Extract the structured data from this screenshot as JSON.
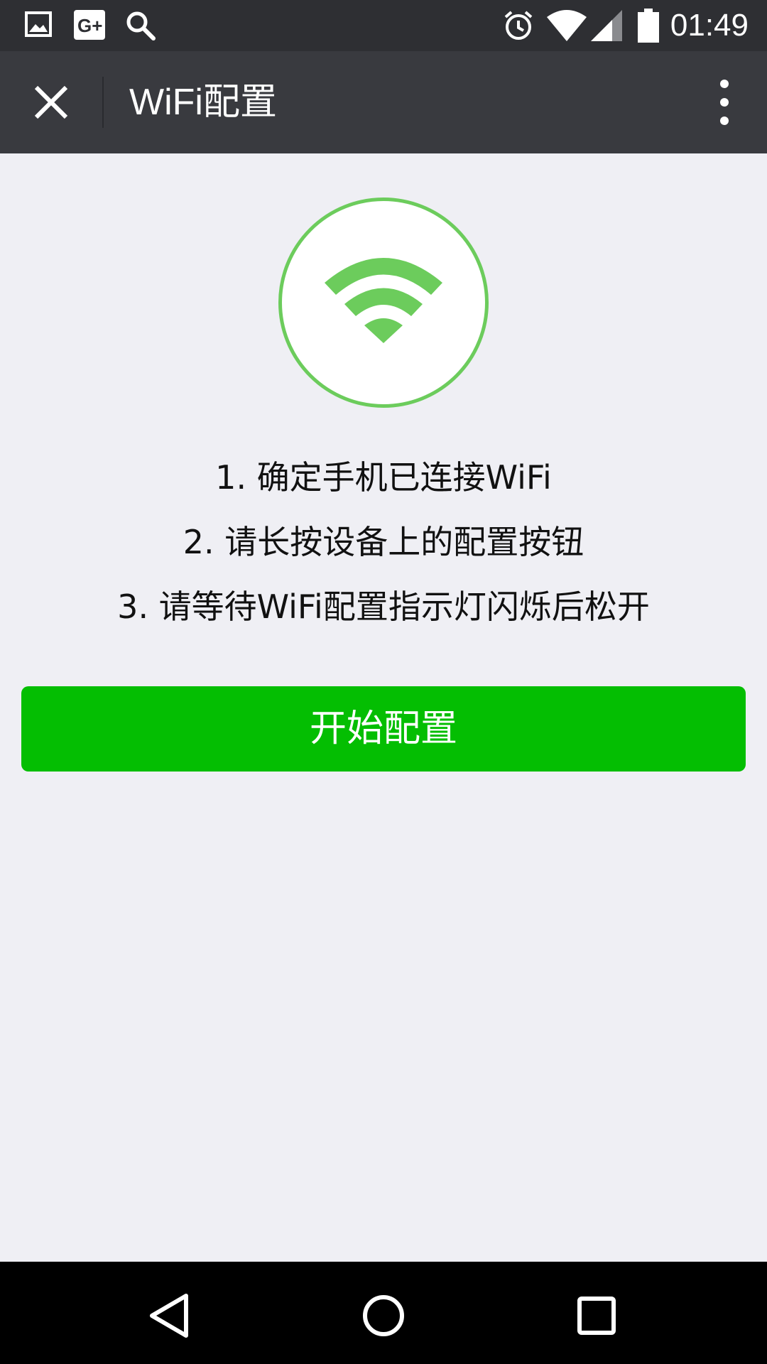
{
  "status_bar": {
    "time": "01:49",
    "left_icons": [
      "image-icon",
      "google-plus-icon",
      "search-icon"
    ],
    "right_icons": [
      "alarm-icon",
      "wifi-signal-icon",
      "cell-signal-icon",
      "battery-icon"
    ]
  },
  "header": {
    "title": "WiFi配置",
    "close_icon": "close-icon",
    "more_icon": "more-vertical-icon"
  },
  "main": {
    "hero_icon": "wifi-icon",
    "steps": [
      "1. 确定手机已连接WiFi",
      "2. 请长按设备上的配置按钮",
      "3. 请等待WiFi配置指示灯闪烁后松开"
    ],
    "start_button": "开始配置"
  },
  "nav_bar": {
    "icons": [
      "back-icon",
      "home-icon",
      "recents-icon"
    ]
  },
  "colors": {
    "status_bar": "#2e2f33",
    "action_bar": "#393a3f",
    "background": "#efeff4",
    "accent_green": "#04be02",
    "wifi_green": "#6ccc5c"
  }
}
